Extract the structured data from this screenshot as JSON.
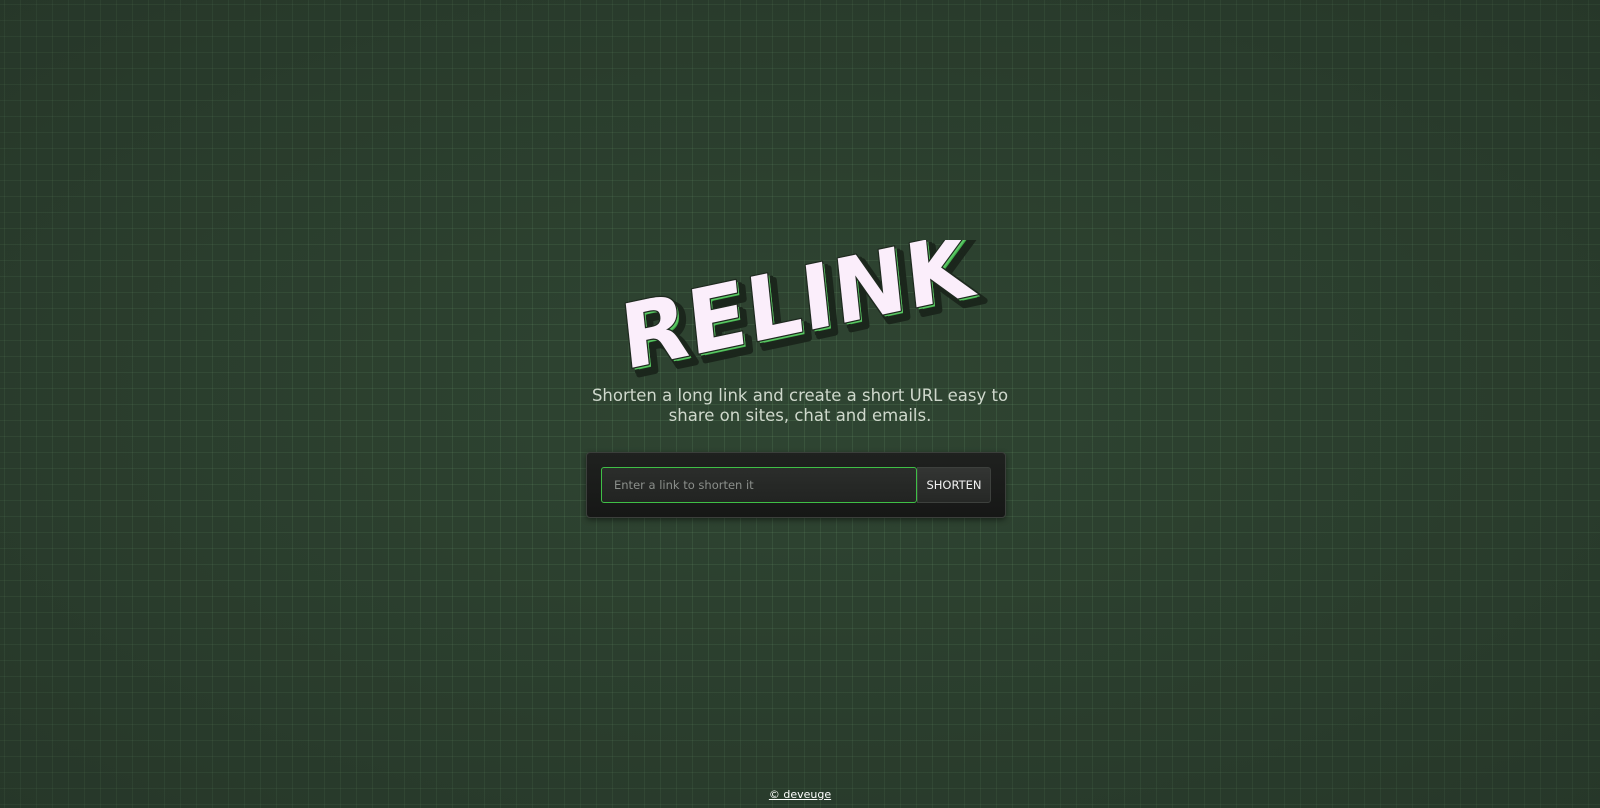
{
  "logo": {
    "text": "RELINK",
    "face_color": "#fbeefb",
    "outline_color": "#1e2a1f",
    "extrude_color": "#3fae4a"
  },
  "tagline": "Shorten a long link and create a short URL easy to share on sites, chat and emails.",
  "form": {
    "input_placeholder": "Enter a link to shorten it",
    "input_value": "",
    "submit_label": "SHORTEN"
  },
  "footer": {
    "credit": "© deveuge"
  },
  "colors": {
    "background": "#2f4532",
    "grid": "#4f6f50",
    "accent": "#3fbf46"
  }
}
